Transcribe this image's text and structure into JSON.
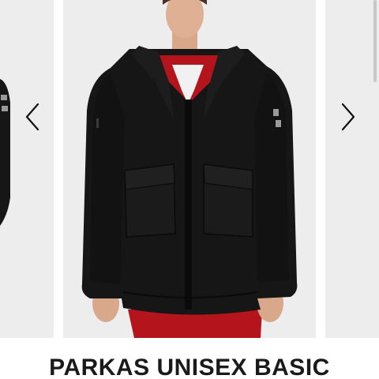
{
  "product": {
    "title": "PARKAS UNISEX BASIC"
  },
  "carousel": {
    "prev_icon": "chevron-left-icon",
    "next_icon": "chevron-right-icon",
    "slide_count_visible": 3
  },
  "colors": {
    "background": "#ffffff",
    "slide_background": "#ededed",
    "jacket": "#151515",
    "reflective_band": "#9a9a9a",
    "pants": "#b4141b",
    "title_text": "#1a1a1a"
  }
}
